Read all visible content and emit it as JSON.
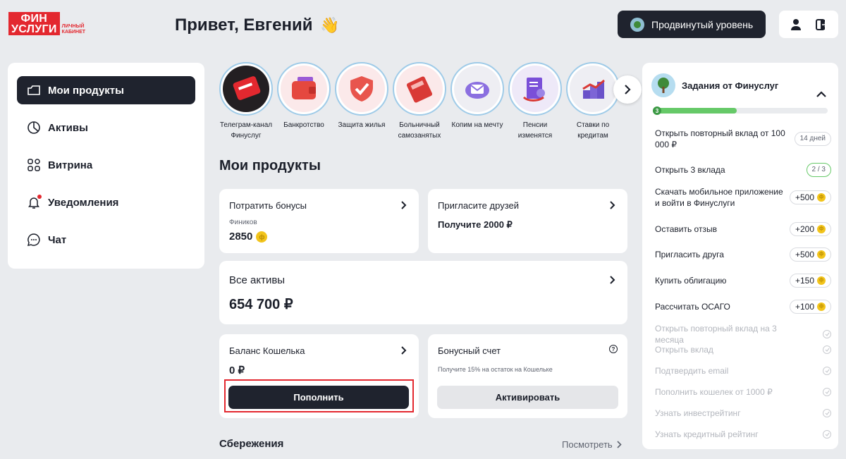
{
  "brand": {
    "line1": "ФИН",
    "line2": "УСЛУГИ",
    "sub1": "ЛИЧНЫЙ",
    "sub2": "КАБИНЕТ",
    "accent": "#e3282f"
  },
  "header": {
    "greeting": "Привет, Евгений",
    "greeting_emoji": "👋",
    "level_button": "Продвинутый уровень",
    "icons": [
      "user-icon",
      "logout-icon"
    ]
  },
  "sidebar": {
    "items": [
      {
        "label": "Мои продукты",
        "icon": "products-icon",
        "active": true
      },
      {
        "label": "Активы",
        "icon": "pie-chart-icon"
      },
      {
        "label": "Витрина",
        "icon": "grid-icon"
      },
      {
        "label": "Уведомления",
        "icon": "bell-icon",
        "badge": true
      },
      {
        "label": "Чат",
        "icon": "chat-icon"
      }
    ]
  },
  "stories": [
    {
      "line1": "Телеграм-канал",
      "line2": "Финуслуг",
      "color": "#e3282f"
    },
    {
      "line1": "Банкротство",
      "line2": "",
      "color": "#e5483f"
    },
    {
      "line1": "Защита жилья",
      "line2": "",
      "color": "#e8554d"
    },
    {
      "line1": "Больничный",
      "line2": "самозанятых",
      "color": "#d93a36"
    },
    {
      "line1": "Копим на мечту",
      "line2": "",
      "color": "#8b6fe0"
    },
    {
      "line1": "Пенсии",
      "line2": "изменятся",
      "color": "#7a4fd8"
    },
    {
      "line1": "Ставки по",
      "line2": "кредитам",
      "color": "#6a52c9"
    }
  ],
  "main": {
    "title": "Мои продукты",
    "bonus_card": {
      "title": "Потратить бонусы",
      "sub": "Фиников",
      "value": "2850"
    },
    "invite_card": {
      "title": "Пригласите друзей",
      "value": "Получите 2000 ₽"
    },
    "assets_card": {
      "title": "Все активы",
      "value": "654 700 ₽"
    },
    "wallet_card": {
      "title": "Баланс Кошелька",
      "value": "0 ₽",
      "button": "Пополнить"
    },
    "bonus_account": {
      "title": "Бонусный счет",
      "sub": "Получите 15% на остаток на Кошельке",
      "button": "Активировать",
      "help": "?"
    },
    "savings": {
      "title": "Сбережения",
      "link": "Посмотреть"
    }
  },
  "tasks": {
    "title": "Задания от Финуслуг",
    "level": "3",
    "progress": 0.48,
    "items": [
      {
        "label": "Открыть повторный вклад от 100 000 ₽",
        "badge": "14 дней",
        "type": "pill"
      },
      {
        "label": "Открыть 3 вклада",
        "badge": "2 / 3",
        "type": "progress"
      },
      {
        "label": "Скачать мобильное приложение и войти в Финуслуги",
        "badge": "+500",
        "type": "reward"
      },
      {
        "label": "Оставить отзыв",
        "badge": "+200",
        "type": "reward"
      },
      {
        "label": "Пригласить друга",
        "badge": "+500",
        "type": "reward"
      },
      {
        "label": "Купить облигацию",
        "badge": "+150",
        "type": "reward"
      },
      {
        "label": "Рассчитать ОСАГО",
        "badge": "+100",
        "type": "reward"
      },
      {
        "label": "Открыть повторный вклад на 3 месяца",
        "type": "done"
      },
      {
        "label": "Открыть вклад",
        "type": "done"
      },
      {
        "label": "Подтвердить email",
        "type": "done"
      },
      {
        "label": "Пополнить кошелек от 1000 ₽",
        "type": "done"
      },
      {
        "label": "Узнать инвестрейтинг",
        "type": "done"
      },
      {
        "label": "Узнать кредитный рейтинг",
        "type": "done"
      }
    ]
  }
}
